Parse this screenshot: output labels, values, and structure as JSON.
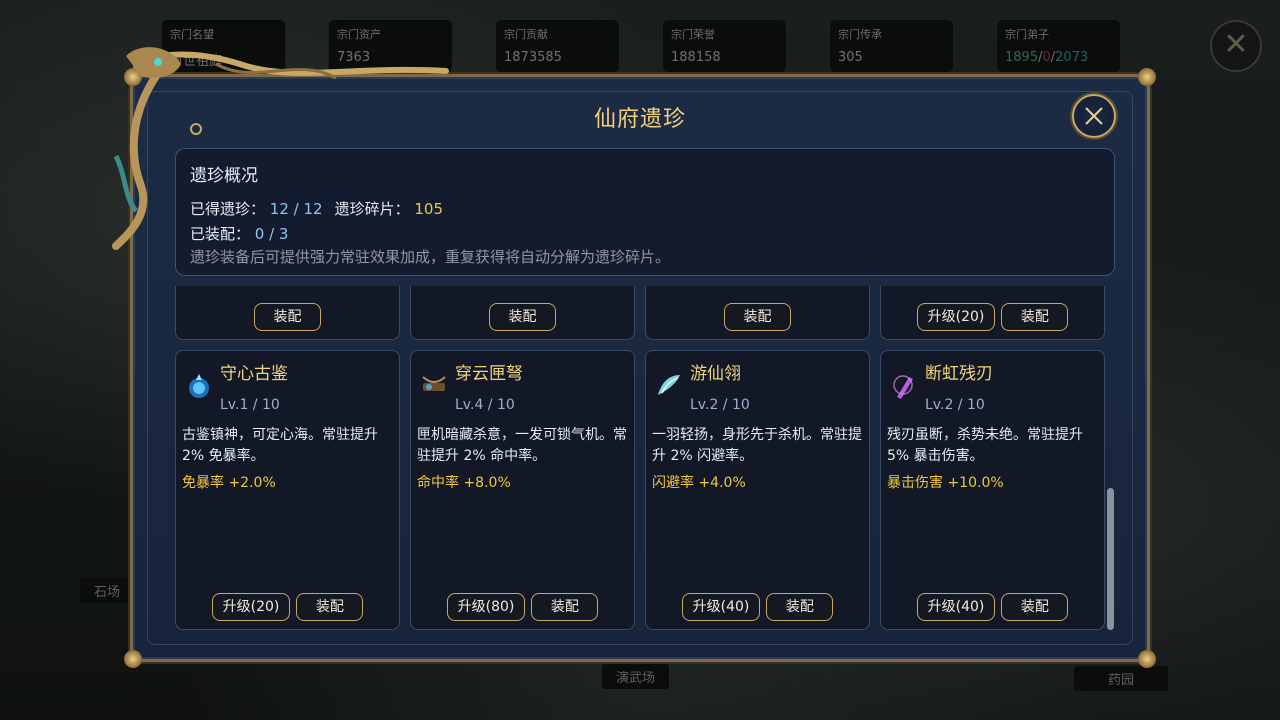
{
  "background": {
    "stats": [
      {
        "label": "宗门名望",
        "value": "万世祖庭"
      },
      {
        "label": "宗门资产",
        "value": "7363"
      },
      {
        "label": "宗门贡献",
        "value": "1873585"
      },
      {
        "label": "宗门荣誉",
        "value": "188158"
      },
      {
        "label": "宗门传承",
        "value": "305"
      },
      {
        "label": "宗门弟子",
        "value_a": "1895",
        "sep1": "/",
        "value_b": "0",
        "sep2": "/",
        "value_c": "2073"
      }
    ],
    "close_symbol": "✕",
    "labels": {
      "stone": "石场",
      "arena": "演武场",
      "herb": "药园"
    }
  },
  "dialog": {
    "title": "仙府遗珍",
    "close_symbol": "✕"
  },
  "overview": {
    "title": "遗珍概况",
    "obtained_label": "已得遗珍：",
    "obtained_value": "12 / 12",
    "fragments_label": "遗珍碎片：",
    "fragments_value": "105",
    "equipped_label": "已装配：",
    "equipped_value": "0 / 3",
    "description": "遗珍装备后可提供强力常驻效果加成，重复获得将自动分解为遗珍碎片。"
  },
  "top_row": [
    {
      "buttons": [
        "装配"
      ]
    },
    {
      "buttons": [
        "装配"
      ]
    },
    {
      "buttons": [
        "装配"
      ]
    },
    {
      "buttons": [
        "升级(20)",
        "装配"
      ]
    }
  ],
  "relics": [
    {
      "name": "守心古鉴",
      "level": "Lv.1 / 10",
      "description": "古鉴镇神，可定心海。常驻提升 2% 免暴率。",
      "bonus": "免暴率 +2.0%",
      "upgrade": "升级(20)",
      "equip": "装配",
      "icon": "mirror-icon",
      "color": "#3aa6e8"
    },
    {
      "name": "穿云匣弩",
      "level": "Lv.4 / 10",
      "description": "匣机暗藏杀意，一发可锁气机。常驻提升 2% 命中率。",
      "bonus": "命中率 +8.0%",
      "upgrade": "升级(80)",
      "equip": "装配",
      "icon": "crossbow-icon",
      "color": "#c08a4a"
    },
    {
      "name": "游仙翎",
      "level": "Lv.2 / 10",
      "description": "一羽轻扬，身形先于杀机。常驻提升 2% 闪避率。",
      "bonus": "闪避率 +4.0%",
      "upgrade": "升级(40)",
      "equip": "装配",
      "icon": "feather-icon",
      "color": "#7fd6e0"
    },
    {
      "name": "断虹残刃",
      "level": "Lv.2 / 10",
      "description": "残刃虽断，杀势未绝。常驻提升 5% 暴击伤害。",
      "bonus": "暴击伤害 +10.0%",
      "upgrade": "升级(40)",
      "equip": "装配",
      "icon": "broken-blade-icon",
      "color": "#b45ee0"
    }
  ]
}
